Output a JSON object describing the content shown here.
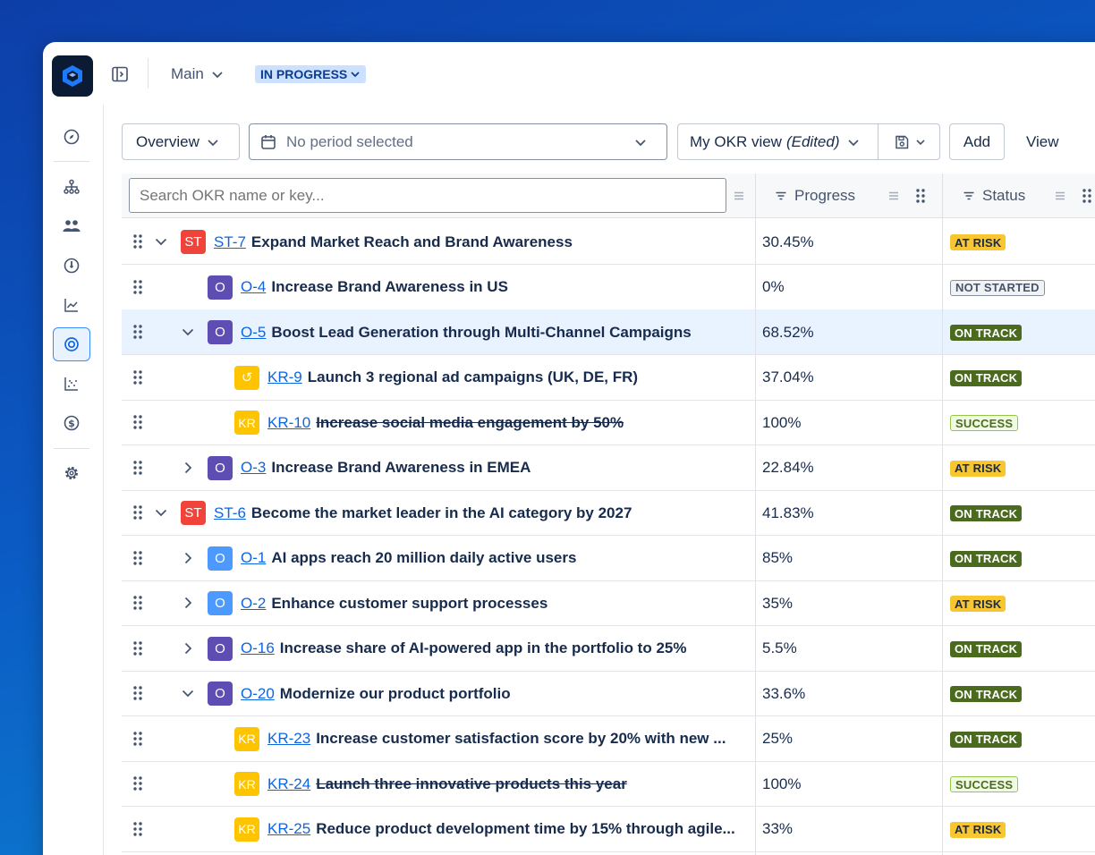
{
  "header": {
    "main_label": "Main",
    "status_label": "IN PROGRESS"
  },
  "sidebar": {
    "items": [
      "compass-icon",
      "hierarchy-icon",
      "people-icon",
      "gauge-icon",
      "line-chart-icon",
      "target-icon",
      "scatter-chart-icon",
      "dollar-icon",
      "settings-icon"
    ],
    "active": "target-icon"
  },
  "toolbar": {
    "overview_label": "Overview",
    "period_placeholder": "No period selected",
    "view_label": "My OKR view",
    "view_suffix": "(Edited)",
    "add_label": "Add",
    "view_btn_label": "View"
  },
  "grid": {
    "search_placeholder": "Search OKR name or key...",
    "col_progress": "Progress",
    "col_status": "Status",
    "rows": [
      {
        "level": 0,
        "expand": "open",
        "badge": "ST",
        "badge_style": "st",
        "key": "ST-7",
        "title": "Expand Market Reach and Brand Awareness",
        "done": false,
        "progress": "30.45%",
        "status": "AT RISK",
        "status_style": "risk",
        "selected": false
      },
      {
        "level": 1,
        "expand": "none",
        "badge": "O",
        "badge_style": "o",
        "key": "O-4",
        "title": "Increase Brand Awareness in US",
        "done": false,
        "progress": "0%",
        "status": "NOT STARTED",
        "status_style": "ns",
        "selected": false
      },
      {
        "level": 1,
        "expand": "open",
        "badge": "O",
        "badge_style": "o",
        "key": "O-5",
        "title": "Boost Lead Generation through Multi-Channel Campaigns",
        "done": false,
        "progress": "68.52%",
        "status": "ON TRACK",
        "status_style": "track",
        "selected": true
      },
      {
        "level": 2,
        "expand": "none",
        "badge": "↺",
        "badge_style": "kr2",
        "key": "KR-9",
        "title": "Launch 3 regional ad campaigns (UK, DE, FR)",
        "done": false,
        "progress": "37.04%",
        "status": "ON TRACK",
        "status_style": "track",
        "selected": false
      },
      {
        "level": 2,
        "expand": "none",
        "badge": "KR",
        "badge_style": "kr",
        "key": "KR-10",
        "title": "Increase social media engagement by 50%",
        "done": true,
        "progress": "100%",
        "status": "SUCCESS",
        "status_style": "succ",
        "selected": false
      },
      {
        "level": 1,
        "expand": "closed",
        "badge": "O",
        "badge_style": "o",
        "key": "O-3",
        "title": "Increase Brand Awareness in EMEA",
        "done": false,
        "progress": "22.84%",
        "status": "AT RISK",
        "status_style": "risk",
        "selected": false
      },
      {
        "level": 0,
        "expand": "open",
        "badge": "ST",
        "badge_style": "st",
        "key": "ST-6",
        "title": "Become the market leader in the AI category by 2027",
        "done": false,
        "progress": "41.83%",
        "status": "ON TRACK",
        "status_style": "track",
        "selected": false
      },
      {
        "level": 1,
        "expand": "closed",
        "badge": "O",
        "badge_style": "ob",
        "key": "O-1",
        "title": "AI apps reach 20 million daily active users",
        "done": false,
        "progress": "85%",
        "status": "ON TRACK",
        "status_style": "track",
        "selected": false
      },
      {
        "level": 1,
        "expand": "closed",
        "badge": "O",
        "badge_style": "ob",
        "key": "O-2",
        "title": "Enhance customer support processes",
        "done": false,
        "progress": "35%",
        "status": "AT RISK",
        "status_style": "risk",
        "selected": false
      },
      {
        "level": 1,
        "expand": "closed",
        "badge": "O",
        "badge_style": "o",
        "key": "O-16",
        "title": "Increase share of AI-powered app in the portfolio to 25%",
        "done": false,
        "progress": "5.5%",
        "status": "ON TRACK",
        "status_style": "track",
        "selected": false
      },
      {
        "level": 1,
        "expand": "open",
        "badge": "O",
        "badge_style": "o",
        "key": "O-20",
        "title": "Modernize our product portfolio",
        "done": false,
        "progress": "33.6%",
        "status": "ON TRACK",
        "status_style": "track",
        "selected": false
      },
      {
        "level": 2,
        "expand": "none",
        "badge": "KR",
        "badge_style": "kr",
        "key": "KR-23",
        "title": "Increase customer satisfaction score by 20% with new ...",
        "done": false,
        "progress": "25%",
        "status": "ON TRACK",
        "status_style": "track",
        "selected": false
      },
      {
        "level": 2,
        "expand": "none",
        "badge": "KR",
        "badge_style": "kr",
        "key": "KR-24",
        "title": "Launch three innovative products this year",
        "done": true,
        "progress": "100%",
        "status": "SUCCESS",
        "status_style": "succ",
        "selected": false
      },
      {
        "level": 2,
        "expand": "none",
        "badge": "KR",
        "badge_style": "kr",
        "key": "KR-25",
        "title": "Reduce product development time by 15% through agile...",
        "done": false,
        "progress": "33%",
        "status": "AT RISK",
        "status_style": "risk",
        "selected": false
      }
    ]
  }
}
